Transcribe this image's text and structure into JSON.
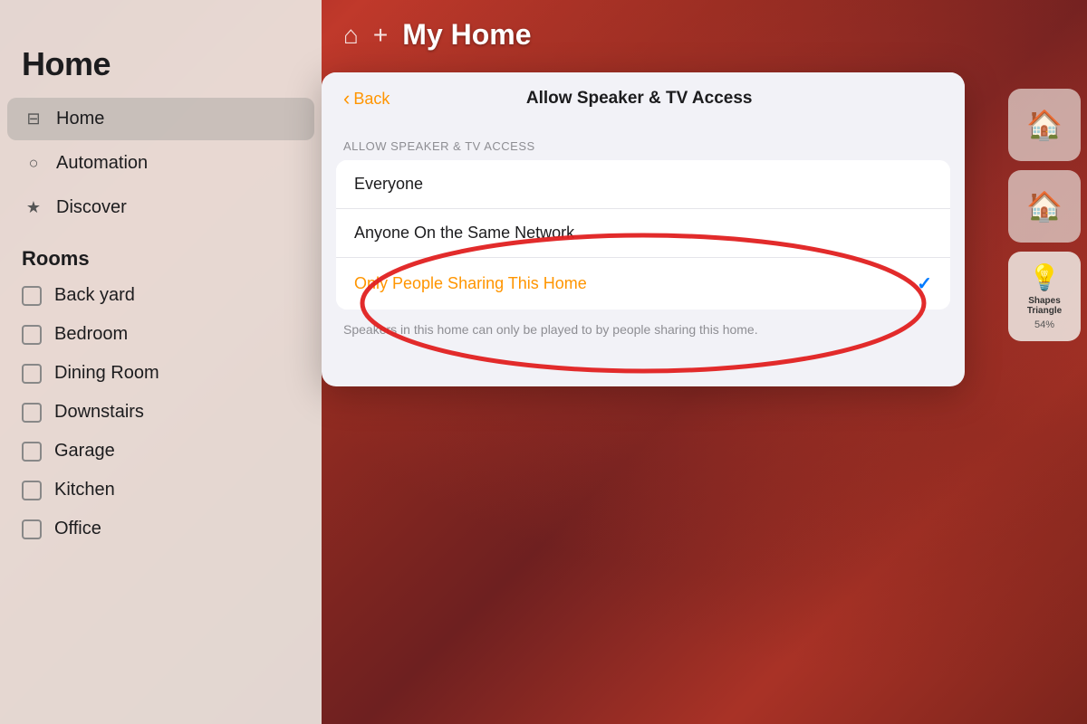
{
  "sidebar": {
    "title": "Home",
    "nav_items": [
      {
        "id": "home",
        "label": "Home",
        "icon": "⊟",
        "active": true
      },
      {
        "id": "automation",
        "label": "Automation",
        "icon": "○"
      },
      {
        "id": "discover",
        "label": "Discover",
        "icon": "★"
      }
    ],
    "rooms_header": "Rooms",
    "rooms": [
      {
        "id": "backyard",
        "label": "Back yard"
      },
      {
        "id": "bedroom",
        "label": "Bedroom"
      },
      {
        "id": "dining_room",
        "label": "Dining Room"
      },
      {
        "id": "downstairs",
        "label": "Downstairs"
      },
      {
        "id": "garage",
        "label": "Garage"
      },
      {
        "id": "kitchen",
        "label": "Kitchen"
      },
      {
        "id": "office",
        "label": "Office"
      }
    ]
  },
  "header": {
    "home_icon": "⌂",
    "add_icon": "+",
    "title": "My Home"
  },
  "modal": {
    "back_label": "Back",
    "title": "Allow Speaker & TV Access",
    "section_label": "ALLOW SPEAKER & TV ACCESS",
    "options": [
      {
        "id": "everyone",
        "label": "Everyone",
        "selected": false
      },
      {
        "id": "same_network",
        "label": "Anyone On the Same Network",
        "selected": false
      },
      {
        "id": "sharing_only",
        "label": "Only People Sharing This Home",
        "selected": true
      }
    ],
    "description": "Speakers in this home can only be played to by people sharing this home.",
    "checkmark": "✓"
  },
  "widgets": [
    {
      "id": "widget1",
      "icon": "🏠",
      "label": ""
    },
    {
      "id": "widget2",
      "icon": "🏠",
      "label": ""
    },
    {
      "id": "widget3",
      "icon": "💡",
      "label": "Shapes\nTriangle",
      "percent": "54%"
    }
  ],
  "colors": {
    "accent_orange": "#ff9500",
    "accent_blue": "#007aff",
    "selected_text": "#ff9500",
    "sidebar_bg": "rgba(235,230,225,0.92)",
    "modal_bg": "#f2f2f7"
  }
}
